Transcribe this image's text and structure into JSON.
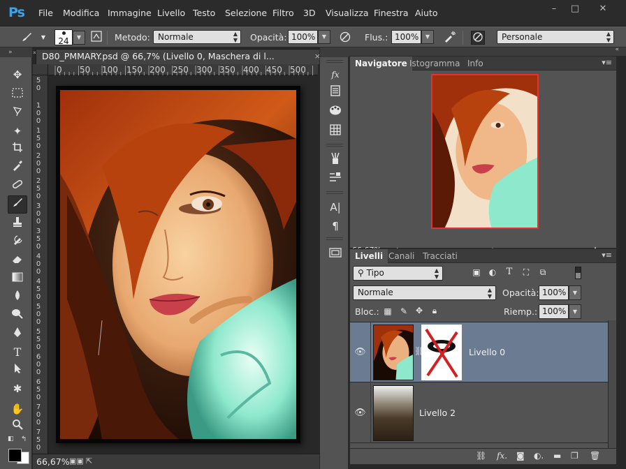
{
  "app": {
    "logo": "Ps",
    "menu": [
      "File",
      "Modifica",
      "Immagine",
      "Livello",
      "Testo",
      "Selezione",
      "Filtro",
      "3D",
      "Visualizza",
      "Finestra",
      "Aiuto"
    ],
    "window_controls": {
      "minimize": "–",
      "maximize": "□",
      "close": "✕"
    }
  },
  "options": {
    "brush_size": "24",
    "metodo_label": "Metodo:",
    "metodo_value": "Normale",
    "opacita_label": "Opacità:",
    "opacita_value": "100%",
    "flusso_label": "Flus.:",
    "flusso_value": "100%",
    "preset_value": "Personale"
  },
  "document": {
    "tab_title": "D80_PMMARY.psd @ 66,7% (Livello 0, Maschera di l...",
    "close": "×",
    "ruler_h": [
      "0",
      "50",
      "100",
      "150",
      "200",
      "250",
      "300",
      "350",
      "400",
      "450",
      "500"
    ],
    "ruler_v": [
      [
        "5",
        "0"
      ],
      [
        "1",
        "0",
        "0"
      ],
      [
        "1",
        "5",
        "0"
      ],
      [
        "2",
        "0",
        "0"
      ],
      [
        "2",
        "5",
        "0"
      ],
      [
        "3",
        "0",
        "0"
      ],
      [
        "3",
        "5",
        "0"
      ],
      [
        "4",
        "0",
        "0"
      ],
      [
        "4",
        "5",
        "0"
      ],
      [
        "5",
        "0",
        "0"
      ],
      [
        "5",
        "5",
        "0"
      ],
      [
        "6",
        "0",
        "0"
      ],
      [
        "6",
        "5",
        "0"
      ],
      [
        "7",
        "0",
        "0"
      ],
      [
        "7",
        "5",
        "0"
      ]
    ],
    "zoom": "66,67%"
  },
  "navigator": {
    "tabs": [
      "Navigatore",
      "Istogramma",
      "Info"
    ],
    "zoom": "66,67%"
  },
  "layers_panel": {
    "tabs": [
      "Livelli",
      "Canali",
      "Tracciati"
    ],
    "filter": "Tipo",
    "blend_mode": "Normale",
    "opacity_label": "Opacità:",
    "opacity_value": "100%",
    "lock_label": "Bloc.:",
    "fill_label": "Riemp.:",
    "fill_value": "100%",
    "layers": [
      {
        "name": "Livello 0",
        "selected": true
      },
      {
        "name": "Livello 2",
        "selected": false
      }
    ]
  },
  "colors": {
    "selection": "#6b7b92",
    "panel": "#535353",
    "nav_frame": "#e8312f"
  }
}
